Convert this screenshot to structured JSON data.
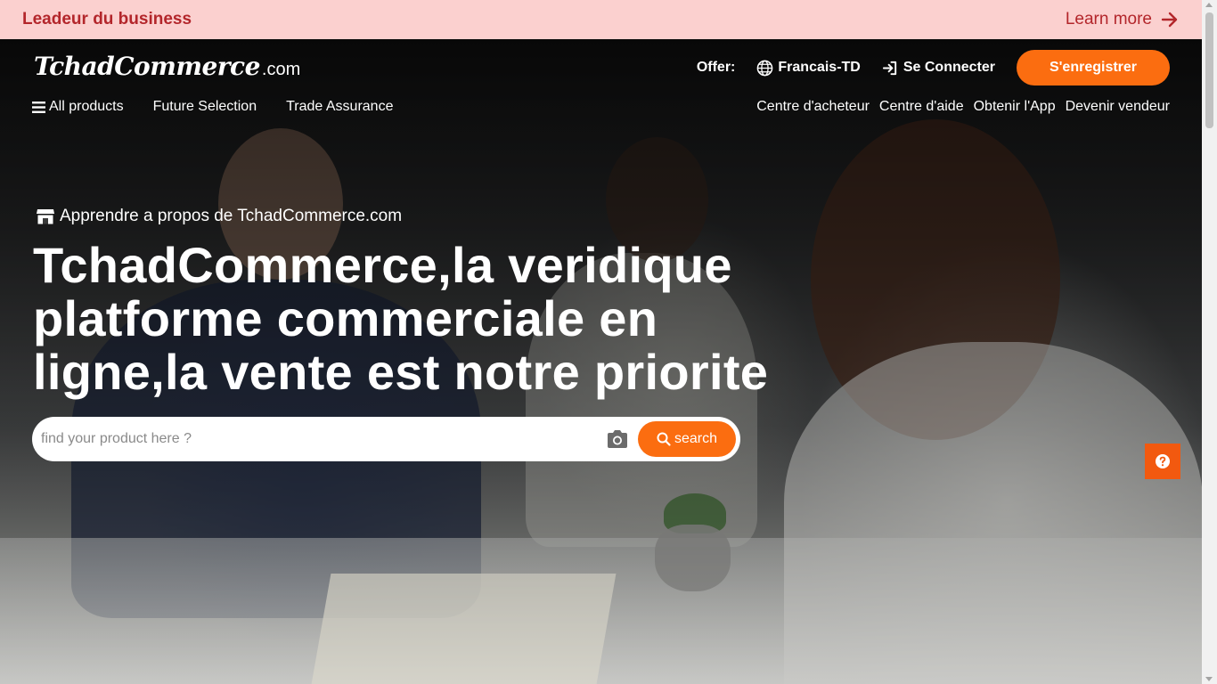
{
  "promo": {
    "title": "Leadeur du business",
    "link_label": "Learn more",
    "icon": "arrow-right-icon"
  },
  "header": {
    "logo_main": "TchadCommerce",
    "logo_tld": ".com",
    "offer_label": "Offer:",
    "language_label": "Francais-TD",
    "login_label": "Se Connecter",
    "register_label": "S'enregistrer"
  },
  "nav": {
    "left": [
      {
        "label": "All products",
        "icon": "menu-icon"
      },
      {
        "label": "Future Selection"
      },
      {
        "label": "Trade Assurance"
      }
    ],
    "right": [
      {
        "label": "Centre d'acheteur"
      },
      {
        "label": "Centre d'aide"
      },
      {
        "label": "Obtenir l'App"
      },
      {
        "label": "Devenir vendeur"
      }
    ]
  },
  "hero": {
    "learn_label": "Apprendre a propos de TchadCommerce.com",
    "title": "TchadCommerce,la veridique platforme commerciale en ligne,la vente est notre priorite"
  },
  "search": {
    "placeholder": "find your product here ?",
    "value": "",
    "button_label": "search"
  },
  "colors": {
    "accent": "#fb6d10",
    "promo_bg": "#fbd0cf",
    "promo_text": "#b3262b",
    "help_bg": "#f2590f"
  }
}
